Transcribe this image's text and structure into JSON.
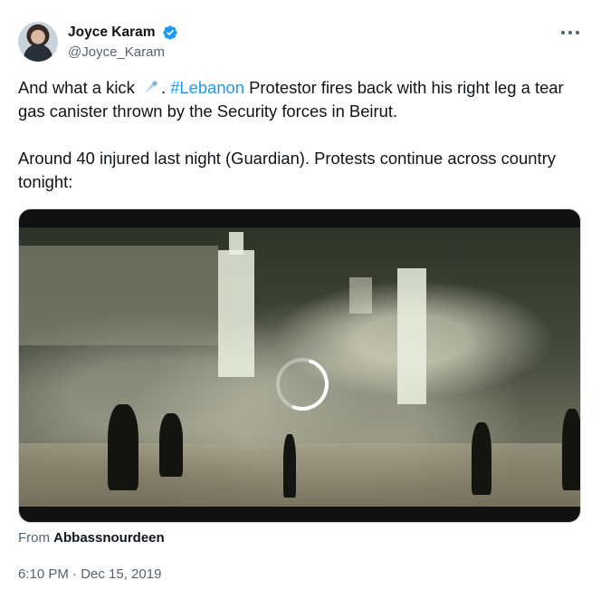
{
  "author": {
    "display_name": "Joyce Karam",
    "handle": "@Joyce_Karam",
    "verified": true,
    "avatar_icon": "avatar-photo"
  },
  "more_icon": "ellipsis-icon",
  "tweet": {
    "line1_prefix": "And what a kick",
    "line1_sep": ".",
    "hashtag": "#Lebanon",
    "line1_rest": " Protestor fires back with his right leg a tear gas canister thrown by the Security forces in Beirut.",
    "line2": "Around 40 injured last night (Guardian). Protests continue across country tonight:",
    "emoji_icon": "comet-icon"
  },
  "media": {
    "type": "video",
    "state": "loading",
    "spinner_icon": "loading-spinner-icon"
  },
  "source": {
    "prefix": "From",
    "name": "Abbassnourdeen"
  },
  "timestamp": "6:10 PM · Dec 15, 2019",
  "colors": {
    "link": "#1d9bf0",
    "text": "#0f1419",
    "secondary": "#536471",
    "verified_badge": "#1d9bf0"
  }
}
